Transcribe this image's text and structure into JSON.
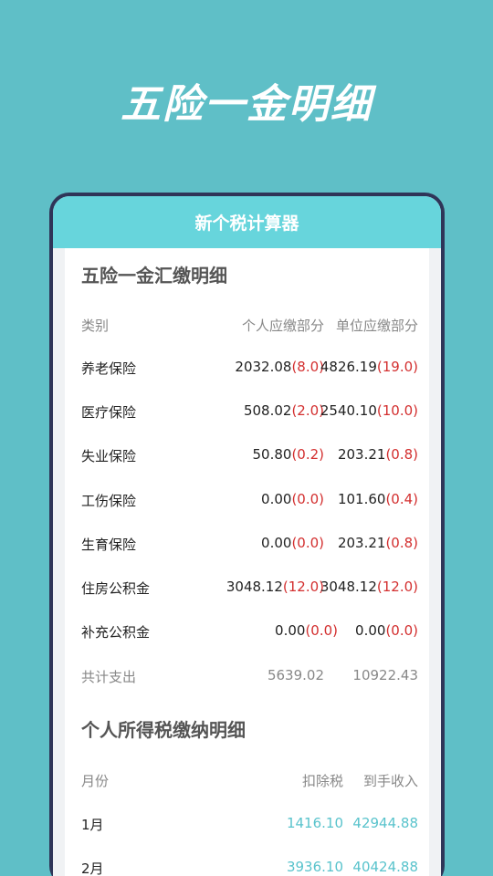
{
  "promo_title": "五险一金明细",
  "app_header": "新个税计算器",
  "insurance": {
    "title": "五险一金汇缴明细",
    "headers": [
      "类别",
      "个人应缴部分",
      "单位应缴部分"
    ],
    "rows": [
      {
        "label": "养老保险",
        "personal": "2032.08",
        "personal_pct": "(8.0)",
        "company": "4826.19",
        "company_pct": "(19.0)"
      },
      {
        "label": "医疗保险",
        "personal": "508.02",
        "personal_pct": "(2.0)",
        "company": "2540.10",
        "company_pct": "(10.0)"
      },
      {
        "label": "失业保险",
        "personal": "50.80",
        "personal_pct": "(0.2)",
        "company": "203.21",
        "company_pct": "(0.8)"
      },
      {
        "label": "工伤保险",
        "personal": "0.00",
        "personal_pct": "(0.0)",
        "company": "101.60",
        "company_pct": "(0.4)"
      },
      {
        "label": "生育保险",
        "personal": "0.00",
        "personal_pct": "(0.0)",
        "company": "203.21",
        "company_pct": "(0.8)"
      },
      {
        "label": "住房公积金",
        "personal": "3048.12",
        "personal_pct": "(12.0)",
        "company": "3048.12",
        "company_pct": "(12.0)"
      },
      {
        "label": "补充公积金",
        "personal": "0.00",
        "personal_pct": "(0.0)",
        "company": "0.00",
        "company_pct": "(0.0)"
      }
    ],
    "total": {
      "label": "共计支出",
      "personal": "5639.02",
      "company": "10922.43"
    }
  },
  "tax": {
    "title": "个人所得税缴纳明细",
    "headers": [
      "月份",
      "扣除税",
      "到手收入"
    ],
    "rows": [
      {
        "month": "1月",
        "tax": "1416.10",
        "income": "42944.88"
      },
      {
        "month": "2月",
        "tax": "3936.10",
        "income": "40424.88"
      }
    ]
  },
  "colors": {
    "background": "#5fbfc7",
    "header": "#67d5dc",
    "accent_red": "#d32f2f",
    "accent_teal": "#59c3cc",
    "phone_frame": "#2f3558"
  }
}
